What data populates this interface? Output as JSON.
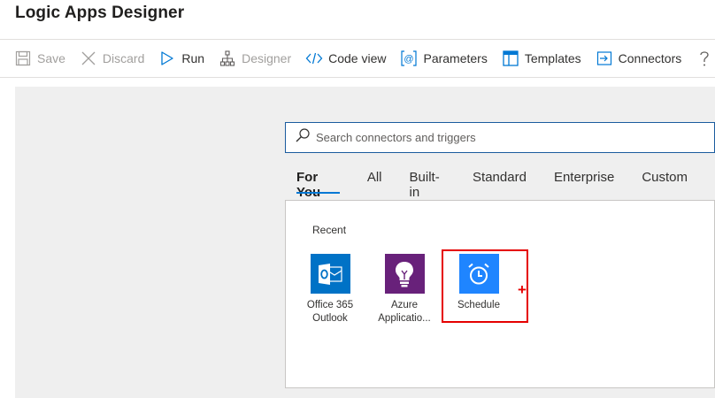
{
  "app": {
    "title": "Logic Apps Designer"
  },
  "toolbar": {
    "save": "Save",
    "discard": "Discard",
    "run": "Run",
    "designer": "Designer",
    "code_view": "Code view",
    "parameters": "Parameters",
    "templates": "Templates",
    "connectors": "Connectors"
  },
  "search": {
    "placeholder": "Search connectors and triggers"
  },
  "tabs": [
    {
      "label": "For You",
      "active": true
    },
    {
      "label": "All"
    },
    {
      "label": "Built-in"
    },
    {
      "label": "Standard"
    },
    {
      "label": "Enterprise"
    },
    {
      "label": "Custom"
    }
  ],
  "results": {
    "section_label": "Recent",
    "items": [
      {
        "line1": "Office 365",
        "line2": "Outlook",
        "icon": "outlook-icon",
        "color": "#0072c6"
      },
      {
        "line1": "Azure",
        "line2": "Applicatio...",
        "icon": "lightbulb-icon",
        "color": "#68217a"
      },
      {
        "line1": "Schedule",
        "line2": "",
        "icon": "alarm-clock-icon",
        "color": "#1f85ff"
      }
    ]
  },
  "annotation": {
    "plus": "+",
    "color": "#e50000"
  }
}
